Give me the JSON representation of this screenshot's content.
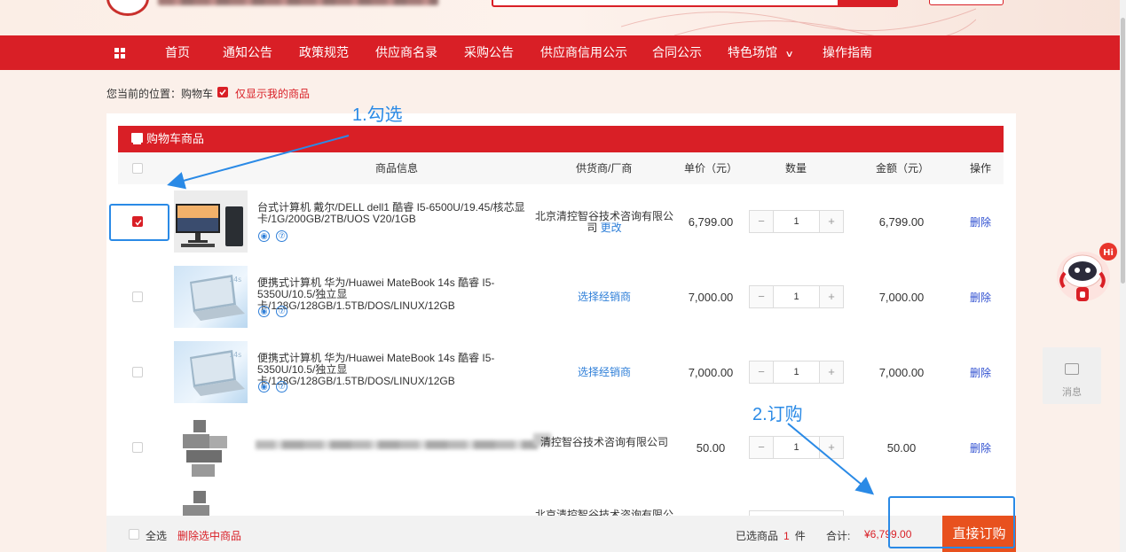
{
  "nav": {
    "items": [
      "首页",
      "通知公告",
      "政策规范",
      "供应商名录",
      "采购公告",
      "供应商信用公示",
      "合同公示",
      "特色场馆",
      "操作指南"
    ]
  },
  "breadcrumb": {
    "label": "您当前的位置：购物车",
    "only_mine": "仅显示我的商品",
    "only_mine_checked": true
  },
  "cart": {
    "title": "购物车商品",
    "columns": [
      "商品信息",
      "供货商/厂商",
      "单价（元）",
      "数量",
      "金额（元）",
      "操作"
    ],
    "rows": [
      {
        "checked": true,
        "name": "台式计算机 戴尔/DELL dell1 酷睿 I5-6500U/19.45/核芯显卡/1G/200GB/2TB/UOS V20/1GB",
        "supplier": "北京清控智谷技术咨询有限公司",
        "supplier_action": "更改",
        "price": "6,799.00",
        "qty": "1",
        "amount": "6,799.00",
        "action": "删除"
      },
      {
        "checked": false,
        "name": "便携式计算机 华为/Huawei MateBook 14s 酷睿 I5-5350U/10.5/独立显卡/128G/128GB/1.5TB/DOS/LINUX/12GB",
        "supplier_action": "选择经销商",
        "price": "7,000.00",
        "qty": "1",
        "amount": "7,000.00",
        "action": "删除"
      },
      {
        "checked": false,
        "name": "便携式计算机 华为/Huawei MateBook 14s 酷睿 I5-5350U/10.5/独立显卡/128G/128GB/1.5TB/DOS/LINUX/12GB",
        "supplier_action": "选择经销商",
        "price": "7,000.00",
        "qty": "1",
        "amount": "7,000.00",
        "action": "删除"
      },
      {
        "checked": false,
        "supplier": "清控智谷技术咨询有限公司",
        "price": "50.00",
        "qty": "1",
        "amount": "50.00",
        "action": "删除"
      },
      {
        "checked": false,
        "supplier": "北京清控智谷技术咨询有限公"
      }
    ],
    "select_all": "全选",
    "delete_selected": "删除选中商品",
    "selected_label": "已选商品",
    "selected_count": "1",
    "selected_unit": "件",
    "total_label": "合计:",
    "total_value": "¥6,799.00",
    "order_button": "直接订购"
  },
  "annotations": {
    "step1": "1.勾选",
    "step2": "2.订购"
  },
  "side": {
    "robot_badge": "Hi",
    "message_label": "消息"
  },
  "colors": {
    "brand_red": "#d91f26",
    "order_orange": "#e8511e",
    "annotation_blue": "#2a8ae6",
    "link_blue": "#2f7fd8"
  }
}
